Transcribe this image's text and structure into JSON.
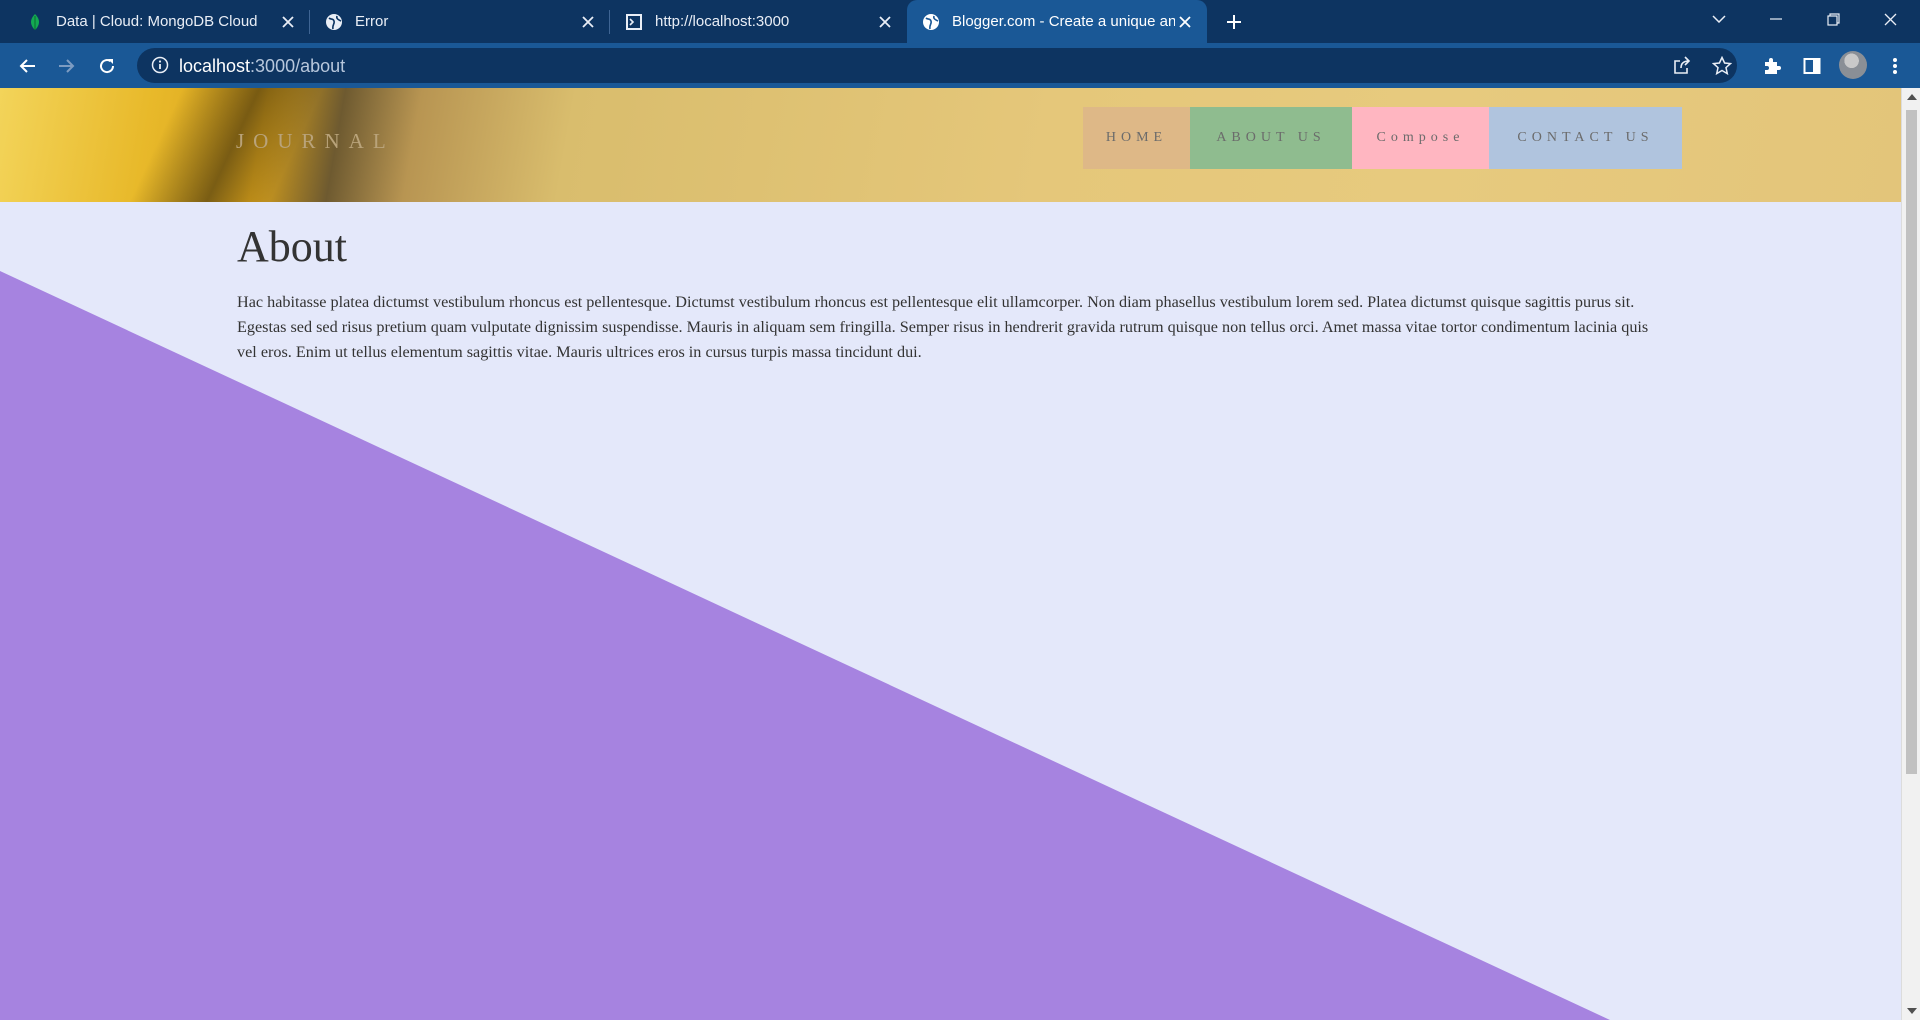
{
  "browser": {
    "tabs": [
      {
        "title": "Data | Cloud: MongoDB Cloud",
        "favicon": "mongodb-leaf-icon",
        "active": false
      },
      {
        "title": "Error",
        "favicon": "globe-icon",
        "active": false
      },
      {
        "title": "http://localhost:3000",
        "favicon": "terminal-icon",
        "active": false
      },
      {
        "title": "Blogger.com - Create a unique an",
        "favicon": "globe-icon",
        "active": true
      }
    ],
    "url_host": "localhost",
    "url_path": ":3000/about"
  },
  "site": {
    "brand": "JOURNAL",
    "nav": [
      {
        "label": "HOME",
        "color": "#deb887"
      },
      {
        "label": "ABOUT US",
        "color": "#8fbc8f"
      },
      {
        "label": "Compose",
        "color": "#ffb6c1"
      },
      {
        "label": "CONTACT US",
        "color": "#b0c4de"
      }
    ]
  },
  "page": {
    "heading": "About",
    "body": "Hac habitasse platea dictumst vestibulum rhoncus est pellentesque. Dictumst vestibulum rhoncus est pellentesque elit ullamcorper. Non diam phasellus vestibulum lorem sed. Platea dictumst quisque sagittis purus sit. Egestas sed sed risus pretium quam vulputate dignissim suspendisse. Mauris in aliquam sem fringilla. Semper risus in hendrerit gravida rutrum quisque non tellus orci. Amet massa vitae tortor condimentum lacinia quis vel eros. Enim ut tellus elementum sagittis vitae. Mauris ultrices eros in cursus turpis massa tincidunt dui."
  },
  "colors": {
    "page_background": "#e4e8fa",
    "diagonal_fill": "#a683e0",
    "browser_frame": "#0d3461",
    "browser_toolbar": "#1a5896"
  }
}
